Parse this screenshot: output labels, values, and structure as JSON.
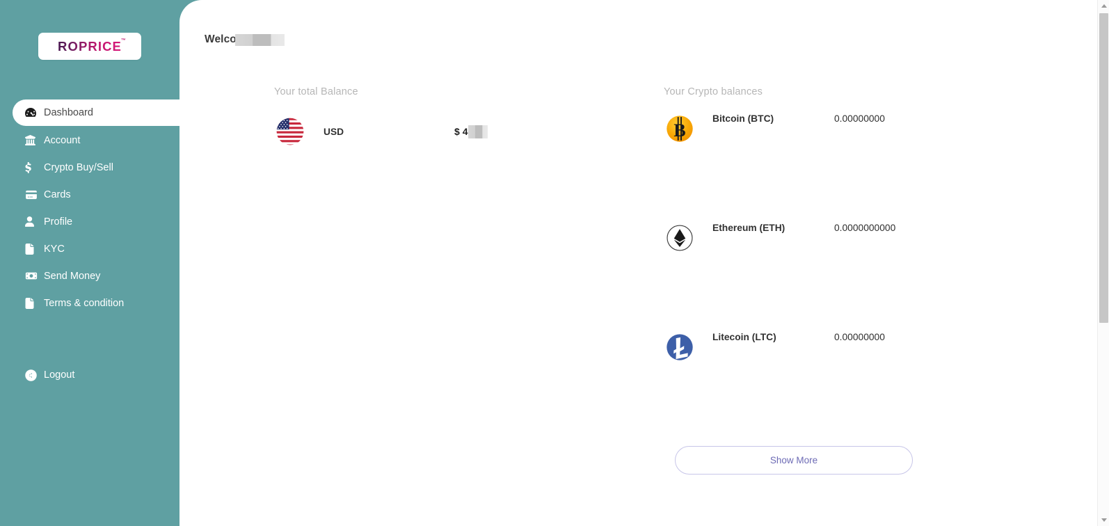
{
  "brand": {
    "logo_text": "ROPRICE",
    "trademark": "™",
    "sidebar_color": "#5fa0a2"
  },
  "sidebar": {
    "items": [
      {
        "id": "dashboard",
        "label": "Dashboard",
        "icon": "dashboard-icon",
        "active": true
      },
      {
        "id": "account",
        "label": "Account",
        "icon": "bank-icon",
        "active": false
      },
      {
        "id": "crypto-buy-sell",
        "label": "Crypto Buy/Sell",
        "icon": "dollar-icon",
        "active": false
      },
      {
        "id": "cards",
        "label": "Cards",
        "icon": "credit-card-icon",
        "active": false
      },
      {
        "id": "profile",
        "label": "Profile",
        "icon": "user-icon",
        "active": false
      },
      {
        "id": "kyc",
        "label": "KYC",
        "icon": "file-icon",
        "active": false
      },
      {
        "id": "send-money",
        "label": "Send Money",
        "icon": "money-bill-icon",
        "active": false
      },
      {
        "id": "terms",
        "label": "Terms & condition",
        "icon": "file-contract-icon",
        "active": false
      }
    ],
    "logout": {
      "label": "Logout",
      "icon": "sign-out-icon"
    }
  },
  "header": {
    "welcome_text": "Welco",
    "name_redacted": true
  },
  "balance": {
    "title": "Your total Balance",
    "rows": [
      {
        "icon": "usd-flag-icon",
        "name": "USD",
        "currency_symbol": "$",
        "amount_visible": "4",
        "amount_redacted": true
      }
    ]
  },
  "crypto": {
    "title": "Your Crypto balances",
    "rows": [
      {
        "icon": "bitcoin-icon",
        "name": "Bitcoin (BTC)",
        "value": "0.00000000",
        "color": "#f7a800"
      },
      {
        "icon": "ethereum-icon",
        "name": "Ethereum (ETH)",
        "value": "0.0000000000",
        "color": "#ffffff"
      },
      {
        "icon": "litecoin-icon",
        "name": "Litecoin (LTC)",
        "value": "0.00000000",
        "color": "#3d5fa8"
      }
    ],
    "show_more_label": "Show More",
    "show_more_color": "#6d6bb5"
  },
  "scrollbar": {
    "visible": true,
    "thumb_top_pct": 2,
    "thumb_height_pct": 59
  }
}
